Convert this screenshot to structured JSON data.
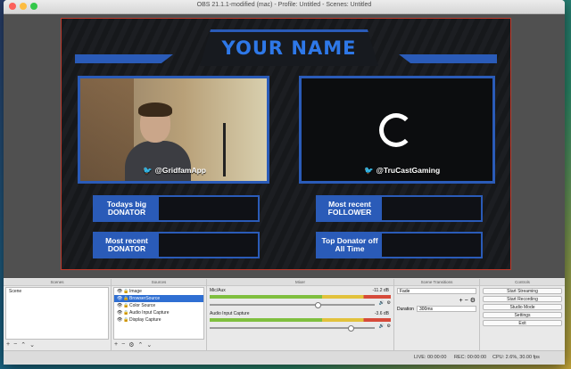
{
  "window": {
    "title": "OBS 21.1.1-modified (mac) - Profile: Untitled - Scenes: Untitled"
  },
  "overlay": {
    "name": "YOUR NAME",
    "left_handle": "@GridfamApp",
    "right_handle": "@TruCastGaming",
    "stats": [
      {
        "label": "Todays big DONATOR"
      },
      {
        "label": "Most recent FOLLOWER"
      },
      {
        "label": "Most recent DONATOR"
      },
      {
        "label": "Top Donator off All Time"
      }
    ]
  },
  "dock": {
    "scenes": {
      "header": "Scenes",
      "items": [
        "Scene"
      ]
    },
    "sources": {
      "header": "Sources",
      "items": [
        "Image",
        "BrowserSource",
        "Color Source",
        "Audio Input Capture",
        "Display Capture"
      ],
      "selected": "BrowserSource"
    },
    "mixer": {
      "header": "Mixer",
      "channels": [
        {
          "name": "Mic/Aux",
          "db": "-11.2 dB",
          "level": 0.78
        },
        {
          "name": "Audio Input Capture",
          "db": "-3.6 dB",
          "level": 0.92
        }
      ]
    },
    "transitions": {
      "header": "Scene Transitions",
      "type": "Fade",
      "duration_label": "Duration",
      "duration": "300ms"
    },
    "controls": {
      "header": "Controls",
      "buttons": [
        "Start Streaming",
        "Start Recording",
        "Studio Mode",
        "Settings",
        "Exit"
      ]
    }
  },
  "status": {
    "live": "LIVE: 00:00:00",
    "rec": "REC: 00:00:00",
    "cpu": "CPU: 2.6%, 30.00 fps"
  },
  "colors": {
    "accent": "#2a5bb8",
    "title_text": "#2e78e8",
    "selection": "#2f6fd3"
  }
}
